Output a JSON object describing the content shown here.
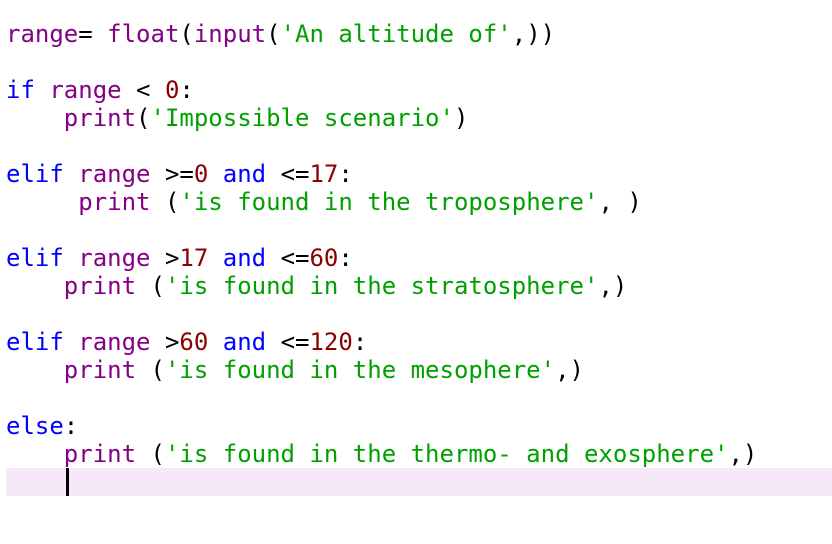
{
  "editor": {
    "language": "python",
    "colors": {
      "keyword": "#0000ff",
      "identifier": "#840084",
      "number": "#8b0000",
      "string": "#00a000",
      "punctuation": "#000000",
      "current_line_highlight": "#f5e9f7"
    },
    "cursor": {
      "line": 17,
      "column": 4
    },
    "lines": [
      {
        "tokens": [
          {
            "t": "id",
            "v": "range"
          },
          {
            "t": "p",
            "v": "= "
          },
          {
            "t": "id",
            "v": "float"
          },
          {
            "t": "p",
            "v": "("
          },
          {
            "t": "id",
            "v": "input"
          },
          {
            "t": "p",
            "v": "("
          },
          {
            "t": "str",
            "v": "'An altitude of'"
          },
          {
            "t": "p",
            "v": ",))"
          }
        ]
      },
      {
        "tokens": []
      },
      {
        "tokens": [
          {
            "t": "kw",
            "v": "if"
          },
          {
            "t": "p",
            "v": " "
          },
          {
            "t": "id",
            "v": "range"
          },
          {
            "t": "p",
            "v": " < "
          },
          {
            "t": "num",
            "v": "0"
          },
          {
            "t": "p",
            "v": ":"
          }
        ]
      },
      {
        "tokens": [
          {
            "t": "p",
            "v": "    "
          },
          {
            "t": "id",
            "v": "print"
          },
          {
            "t": "p",
            "v": "("
          },
          {
            "t": "str",
            "v": "'Impossible scenario'"
          },
          {
            "t": "p",
            "v": ")"
          }
        ]
      },
      {
        "tokens": []
      },
      {
        "tokens": [
          {
            "t": "kw",
            "v": "elif"
          },
          {
            "t": "p",
            "v": " "
          },
          {
            "t": "id",
            "v": "range"
          },
          {
            "t": "p",
            "v": " >="
          },
          {
            "t": "num",
            "v": "0"
          },
          {
            "t": "p",
            "v": " "
          },
          {
            "t": "kw",
            "v": "and"
          },
          {
            "t": "p",
            "v": " <="
          },
          {
            "t": "num",
            "v": "17"
          },
          {
            "t": "p",
            "v": ":"
          }
        ]
      },
      {
        "tokens": [
          {
            "t": "p",
            "v": "     "
          },
          {
            "t": "id",
            "v": "print"
          },
          {
            "t": "p",
            "v": " ("
          },
          {
            "t": "str",
            "v": "'is found in the troposphere'"
          },
          {
            "t": "p",
            "v": ", )"
          }
        ]
      },
      {
        "tokens": []
      },
      {
        "tokens": [
          {
            "t": "kw",
            "v": "elif"
          },
          {
            "t": "p",
            "v": " "
          },
          {
            "t": "id",
            "v": "range"
          },
          {
            "t": "p",
            "v": " >"
          },
          {
            "t": "num",
            "v": "17"
          },
          {
            "t": "p",
            "v": " "
          },
          {
            "t": "kw",
            "v": "and"
          },
          {
            "t": "p",
            "v": " <="
          },
          {
            "t": "num",
            "v": "60"
          },
          {
            "t": "p",
            "v": ":"
          }
        ]
      },
      {
        "tokens": [
          {
            "t": "p",
            "v": "    "
          },
          {
            "t": "id",
            "v": "print"
          },
          {
            "t": "p",
            "v": " ("
          },
          {
            "t": "str",
            "v": "'is found in the stratosphere'"
          },
          {
            "t": "p",
            "v": ",)"
          }
        ]
      },
      {
        "tokens": []
      },
      {
        "tokens": [
          {
            "t": "kw",
            "v": "elif"
          },
          {
            "t": "p",
            "v": " "
          },
          {
            "t": "id",
            "v": "range"
          },
          {
            "t": "p",
            "v": " >"
          },
          {
            "t": "num",
            "v": "60"
          },
          {
            "t": "p",
            "v": " "
          },
          {
            "t": "kw",
            "v": "and"
          },
          {
            "t": "p",
            "v": " <="
          },
          {
            "t": "num",
            "v": "120"
          },
          {
            "t": "p",
            "v": ":"
          }
        ]
      },
      {
        "tokens": [
          {
            "t": "p",
            "v": "    "
          },
          {
            "t": "id",
            "v": "print"
          },
          {
            "t": "p",
            "v": " ("
          },
          {
            "t": "str",
            "v": "'is found in the mesophere'"
          },
          {
            "t": "p",
            "v": ",)"
          }
        ]
      },
      {
        "tokens": []
      },
      {
        "tokens": [
          {
            "t": "kw",
            "v": "else"
          },
          {
            "t": "p",
            "v": ":"
          }
        ]
      },
      {
        "tokens": [
          {
            "t": "p",
            "v": "    "
          },
          {
            "t": "id",
            "v": "print"
          },
          {
            "t": "p",
            "v": " ("
          },
          {
            "t": "str",
            "v": "'is found in the thermo- and exosphere'"
          },
          {
            "t": "p",
            "v": ",)"
          }
        ]
      },
      {
        "tokens": [
          {
            "t": "p",
            "v": "    "
          }
        ]
      }
    ]
  }
}
